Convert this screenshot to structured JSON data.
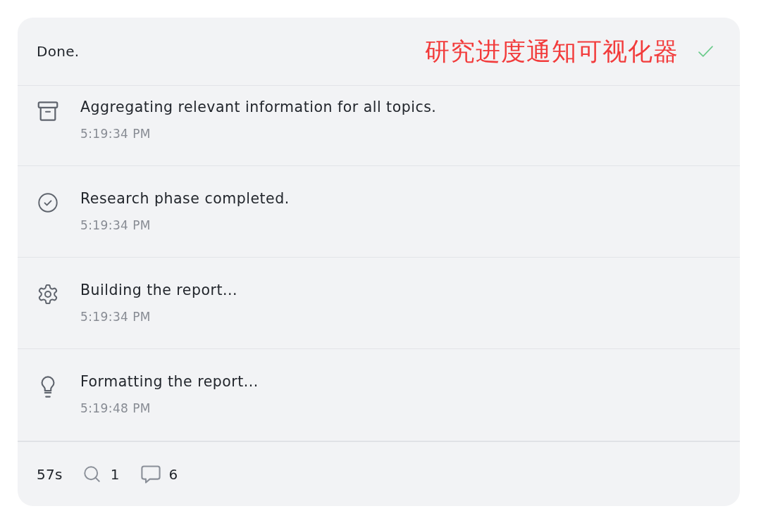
{
  "header": {
    "status": "Done.",
    "annotation": "研究进度通知可视化器",
    "done": true
  },
  "events": [
    {
      "kind": "archive",
      "message": "Aggregating relevant information for all topics.",
      "time": "5:19:34 PM"
    },
    {
      "kind": "check",
      "message": "Research phase completed.",
      "time": "5:19:34 PM"
    },
    {
      "kind": "gear",
      "message": "Building the report...",
      "time": "5:19:34 PM"
    },
    {
      "kind": "bulb",
      "message": "Formatting the report...",
      "time": "5:19:48 PM"
    }
  ],
  "footer": {
    "duration": "57s",
    "searches": "1",
    "messages": "6"
  }
}
